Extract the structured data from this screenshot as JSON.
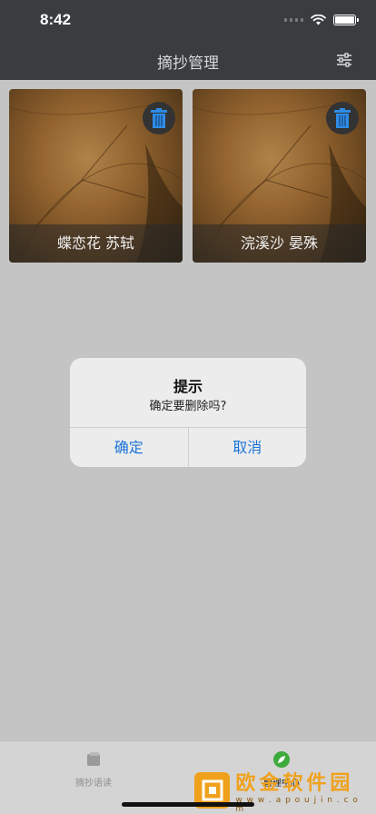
{
  "status_bar": {
    "time": "8:42"
  },
  "nav": {
    "title": "摘抄管理",
    "settings_icon": "sliders-icon"
  },
  "cards": [
    {
      "caption": "蝶恋花  苏轼",
      "delete_icon": "trash-icon"
    },
    {
      "caption": "浣溪沙 晏殊",
      "delete_icon": "trash-icon"
    }
  ],
  "alert": {
    "title": "提示",
    "message": "确定要删除吗?",
    "confirm_label": "确定",
    "cancel_label": "取消",
    "button_color": "#1a73d9"
  },
  "tab_bar": {
    "tabs": [
      {
        "label": "摘抄语读",
        "icon": "book-icon",
        "active": false
      },
      {
        "label": "管理中心",
        "icon": "leaf-icon",
        "active": true
      }
    ]
  },
  "watermark": {
    "main": "欧金软件园",
    "sub": "w w w . a p o u j i n . c o m"
  },
  "colors": {
    "nav_bg": "#3a3d40",
    "page_bg": "#c4c4c4",
    "active_tab": "#3caa3c"
  }
}
